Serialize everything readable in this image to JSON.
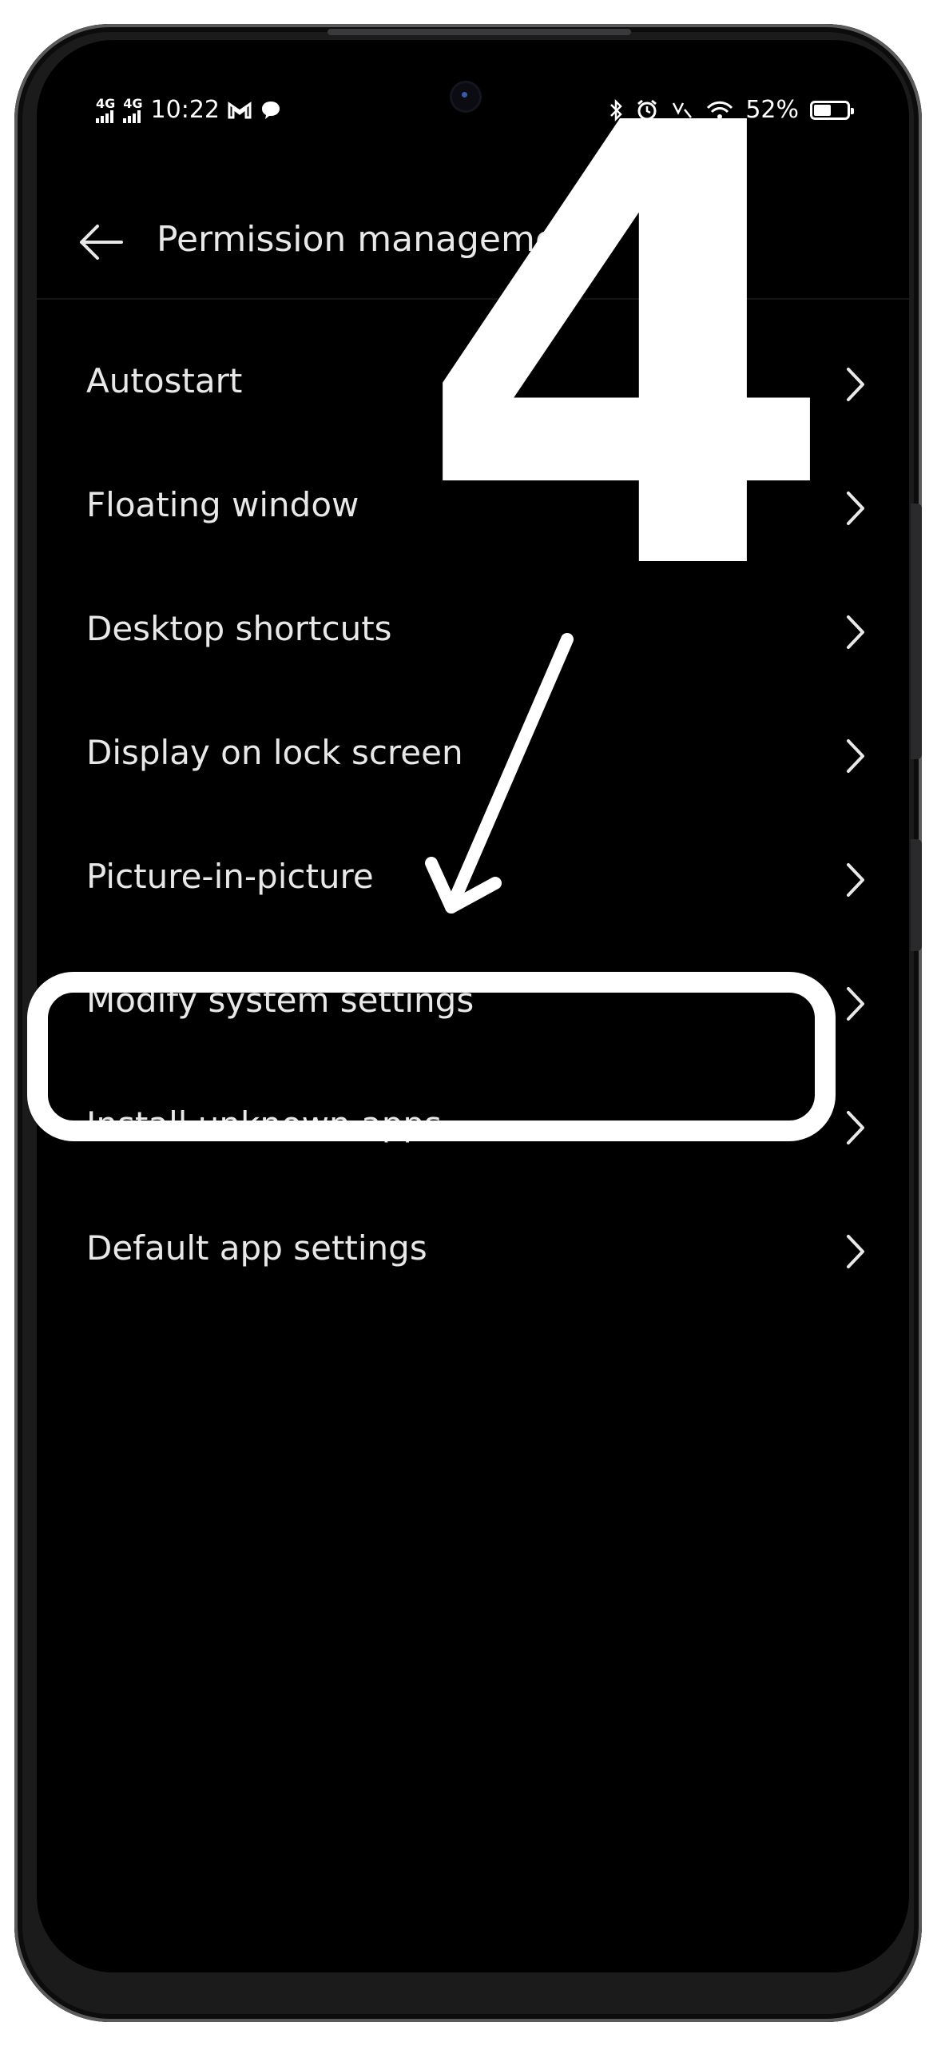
{
  "status_bar": {
    "network_1": "4G",
    "network_2": "4G",
    "time": "10:22",
    "battery": "52%",
    "battery_level": 0.52,
    "icons": [
      "gmail-icon",
      "message-icon",
      "bluetooth-icon",
      "alarm-icon",
      "volte-icon",
      "wifi-icon",
      "battery-icon"
    ]
  },
  "header": {
    "title": "Permission management"
  },
  "list": {
    "items": [
      {
        "label": "Autostart"
      },
      {
        "label": "Floating window"
      },
      {
        "label": "Desktop shortcuts"
      },
      {
        "label": "Display on lock screen"
      },
      {
        "label": "Picture-in-picture"
      },
      {
        "label": "Modify system settings"
      },
      {
        "label": "Install unknown apps"
      },
      {
        "label": "Default app settings"
      }
    ]
  },
  "overlay": {
    "step_number": "4",
    "highlighted_item": "Install unknown apps"
  }
}
